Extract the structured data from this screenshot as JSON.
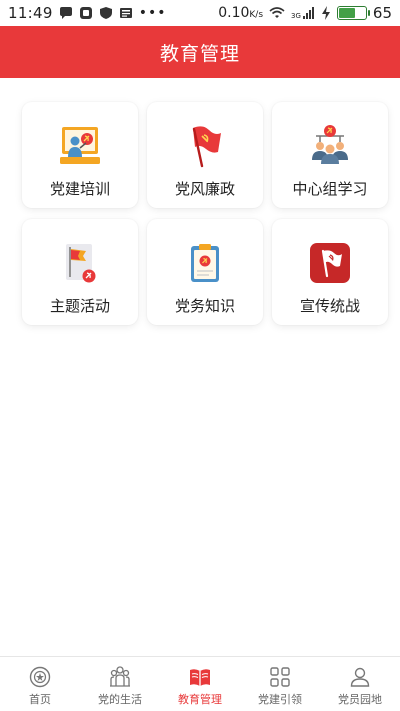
{
  "status_bar": {
    "time": "11:49",
    "network_speed": "0.10",
    "network_unit": "K/s",
    "signal_label": "3G",
    "battery_level": "65"
  },
  "header": {
    "title": "教育管理"
  },
  "grid": {
    "items": [
      {
        "label": "党建培训",
        "icon": "training-icon"
      },
      {
        "label": "党风廉政",
        "icon": "party-flag-icon"
      },
      {
        "label": "中心组学习",
        "icon": "group-study-icon"
      },
      {
        "label": "主题活动",
        "icon": "theme-activity-icon"
      },
      {
        "label": "党务知识",
        "icon": "clipboard-icon"
      },
      {
        "label": "宣传统战",
        "icon": "propaganda-flag-icon"
      }
    ]
  },
  "bottom_nav": {
    "items": [
      {
        "label": "首页",
        "icon": "home-emblem-icon",
        "active": false
      },
      {
        "label": "党的生活",
        "icon": "people-icon",
        "active": false
      },
      {
        "label": "教育管理",
        "icon": "book-icon",
        "active": true
      },
      {
        "label": "党建引领",
        "icon": "grid-icon",
        "active": false
      },
      {
        "label": "党员园地",
        "icon": "user-icon",
        "active": false
      }
    ]
  },
  "colors": {
    "brand_red": "#e8393a",
    "active_nav": "#e8393a",
    "battery_green": "#43a047"
  }
}
